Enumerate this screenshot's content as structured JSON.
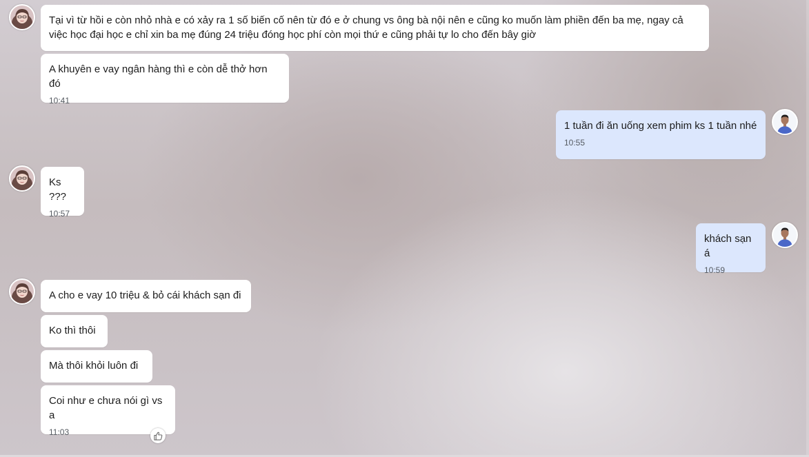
{
  "messages": [
    {
      "sender": "other",
      "text": "Tại vì từ hồi e còn nhỏ nhà e có xảy ra 1 số biến cố nên từ đó e ở chung vs ông bà nội nên e cũng ko muốn làm phiền đến ba mẹ, ngay cả việc học đại học e chỉ xin ba mẹ đúng 24 triệu đóng học phí còn mọi thứ e cũng phải tự lo cho đến bây giờ"
    },
    {
      "sender": "other",
      "text": "A khuyên e vay ngân hàng thì e còn dễ thở hơn đó",
      "time": "10:41"
    },
    {
      "sender": "me",
      "text": "1 tuần đi ăn uống xem phim ks 1 tuần nhé",
      "time": "10:55"
    },
    {
      "sender": "other",
      "text": "Ks ???",
      "time": "10:57"
    },
    {
      "sender": "me",
      "text": "khách sạn á",
      "time": "10:59"
    },
    {
      "sender": "other",
      "text": "A cho e vay 10 triệu & bỏ cái khách sạn đi"
    },
    {
      "sender": "other",
      "text": "Ko thì thôi"
    },
    {
      "sender": "other",
      "text": "Mà thôi khỏi luôn đi"
    },
    {
      "sender": "other",
      "text": "Coi như e chưa nói gì vs a",
      "time": "11:03",
      "reaction": "thumbs-up"
    }
  ],
  "colors": {
    "incoming_bubble": "#ffffff",
    "outgoing_bubble": "#dce7fd",
    "timestamp": "#555a61",
    "text": "#1c1c1c"
  }
}
